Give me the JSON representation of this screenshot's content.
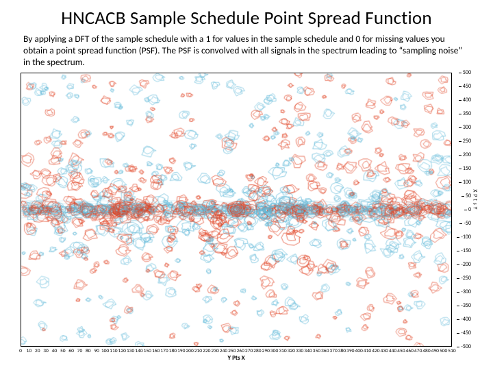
{
  "title": "HNCACB Sample Schedule Point Spread Function",
  "description": "By applying a DFT of the sample schedule with a 1 for values in the sample schedule and 0 for missing values you obtain a point spread function (PSF). The PSF is convolved with all signals in the spectrum leading to “sampling noise” in the spectrum.",
  "chart_data": {
    "type": "heatmap",
    "xlabel": "Y Pts X",
    "ylabel_lines": [
      "X",
      "P",
      "t",
      "s",
      "Y"
    ],
    "xlim": [
      0,
      510
    ],
    "ylim": [
      -500,
      500
    ],
    "xticks": [
      0,
      10,
      20,
      30,
      40,
      50,
      60,
      70,
      80,
      90,
      100,
      110,
      120,
      130,
      140,
      150,
      160,
      170,
      180,
      190,
      200,
      210,
      220,
      230,
      240,
      250,
      260,
      270,
      280,
      290,
      300,
      310,
      320,
      330,
      340,
      350,
      360,
      370,
      380,
      390,
      400,
      410,
      420,
      430,
      440,
      450,
      460,
      470,
      480,
      490,
      500,
      510
    ],
    "yticks": [
      -500,
      -450,
      -400,
      -350,
      -300,
      -250,
      -200,
      -150,
      -100,
      -50,
      0,
      50,
      100,
      150,
      200,
      250,
      300,
      350,
      400,
      450,
      500
    ],
    "note": "2D NMR point spread function contour map. Positive contours drawn in light blue (~#5fb8d8), negative in red (~#e04020). Speckle pattern with a strong central peak at (255, 0) and approximate mirror symmetry."
  },
  "colors": {
    "pos": "#5fb8d8",
    "neg": "#e04020"
  }
}
